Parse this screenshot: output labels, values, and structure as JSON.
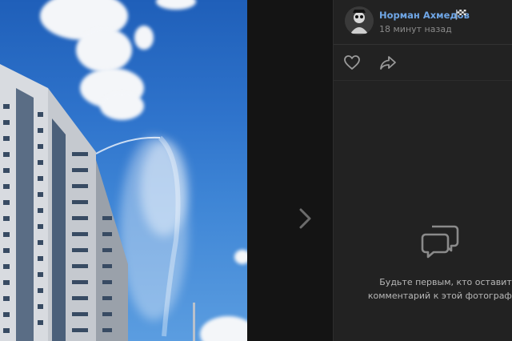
{
  "post": {
    "author": "Норман Ахмедов",
    "time": "18 минут назад"
  },
  "comments": {
    "empty_line1": "Будьте первым, кто оставит",
    "empty_line2": "комментарий к этой фотографии"
  },
  "icons": {
    "like": "heart-icon",
    "share": "share-arrow-icon",
    "next": "chevron-right-icon",
    "comments": "comment-bubbles-icon",
    "flag": "checkered-flag-icon"
  },
  "colors": {
    "background": "#222222",
    "stage": "#141414",
    "accent": "#6fa6e6",
    "muted": "#8a8a8a"
  }
}
